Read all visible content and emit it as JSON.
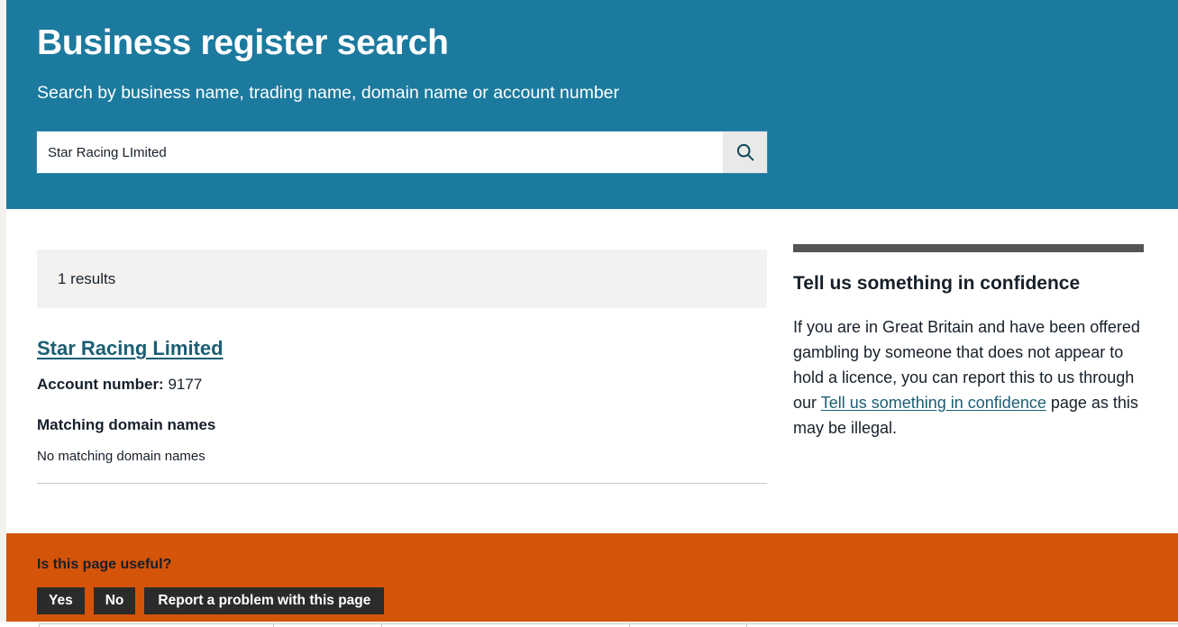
{
  "header": {
    "title": "Business register search",
    "subtitle": "Search by business name, trading name, domain name or account number",
    "accent_color": "#1c7a9e"
  },
  "search": {
    "value": "Star Racing LImited",
    "placeholder": "Search by business name, trading name, domain name or account number",
    "button_icon": "search-icon",
    "button_label": "Search"
  },
  "results": {
    "count_text": "1 results",
    "items": [
      {
        "name": "Star Racing Limited",
        "account_number_label": "Account number:",
        "account_number": "9177",
        "domain_heading": "Matching domain names",
        "domain_text": "No matching domain names"
      }
    ]
  },
  "aside": {
    "title": "Tell us something in confidence",
    "body_before_link": "If you are in Great Britain and have been offered gambling by someone that does not appear to hold a licence, you can report this to us through our ",
    "link_text": "Tell us something in confidence",
    "body_after_link": " page as this may be illegal.",
    "rule_color": "#555555"
  },
  "feedback": {
    "question": "Is this page useful?",
    "yes_label": "Yes",
    "no_label": "No",
    "report_label": "Report a problem with this page",
    "background_color": "#d4540a",
    "button_color": "#2b2b2b"
  }
}
